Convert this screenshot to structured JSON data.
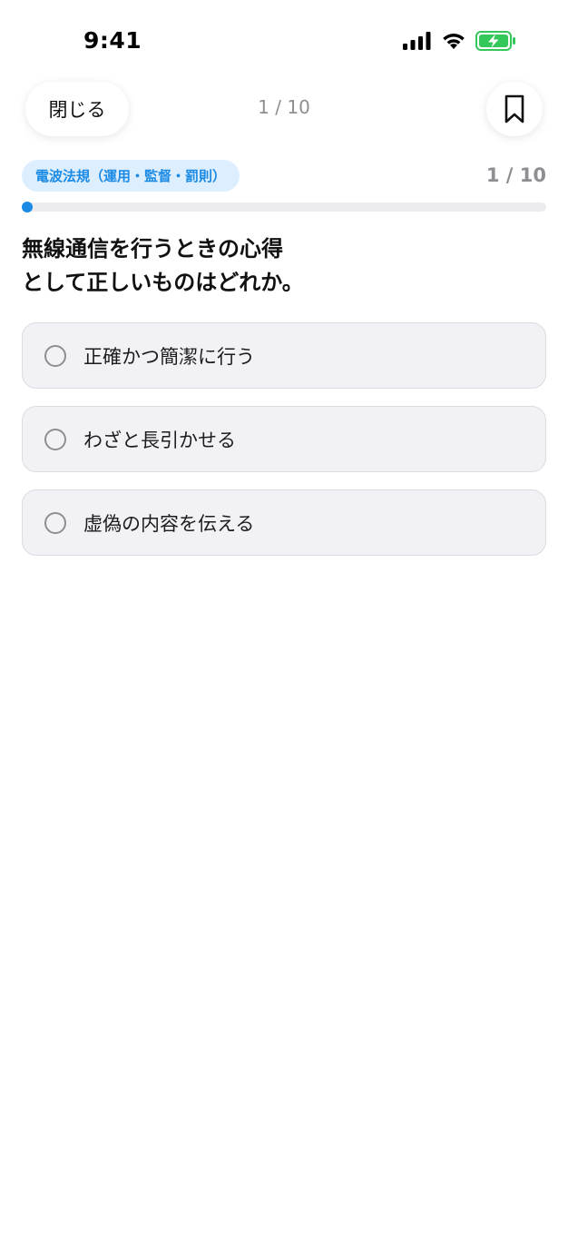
{
  "status_bar": {
    "time": "9:41",
    "icons": [
      "cellular-signal-icon",
      "wifi-icon",
      "battery-charging-icon"
    ],
    "battery_color": "#34c759"
  },
  "nav": {
    "close_label": "閉じる",
    "progress": "1 / 10",
    "bookmark_icon": "bookmark-icon"
  },
  "quiz": {
    "category": "電波法規（運用・監督・罰則）",
    "count": "1 / 10",
    "progress_fraction": 0.1,
    "question_lines": [
      "無線通信を行うときの心得",
      "として正しいものはどれか。"
    ],
    "options": [
      {
        "label": "正確かつ簡潔に行う"
      },
      {
        "label": "わざと長引かせる"
      },
      {
        "label": "虚偽の内容を伝える"
      }
    ]
  },
  "colors": {
    "accent": "#1a8ae5",
    "tag_background": "#ddeefe",
    "option_background": "#f2f2f6"
  }
}
